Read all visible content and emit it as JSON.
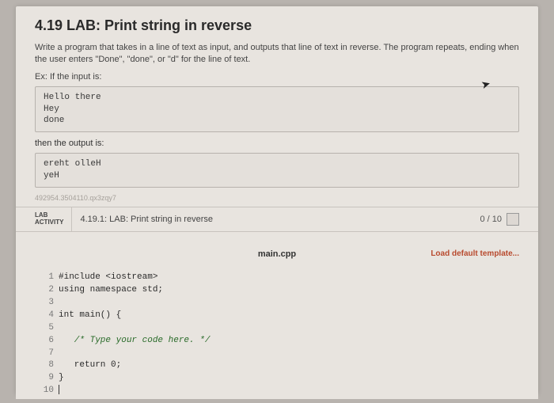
{
  "title": "4.19 LAB: Print string in reverse",
  "description": "Write a program that takes in a line of text as input, and outputs that line of text in reverse. The program repeats, ending when the user enters \"Done\", \"done\", or \"d\" for the line of text.",
  "ex_label": "Ex: If the input is:",
  "input_example": "Hello there\nHey\ndone",
  "then_label": "then the output is:",
  "output_example": "ereht olleH\nyeH",
  "watermark": "492954.3504110.qx3zqy7",
  "activity": {
    "label_line1": "LAB",
    "label_line2": "ACTIVITY",
    "title": "4.19.1: LAB: Print string in reverse",
    "score": "0 / 10"
  },
  "file": {
    "name": "main.cpp",
    "load_template": "Load default template..."
  },
  "code": {
    "lines": [
      "#include <iostream>",
      "using namespace std;",
      "",
      "int main() {",
      "",
      "   /* Type your code here. */",
      "",
      "   return 0;",
      "}",
      ""
    ]
  }
}
